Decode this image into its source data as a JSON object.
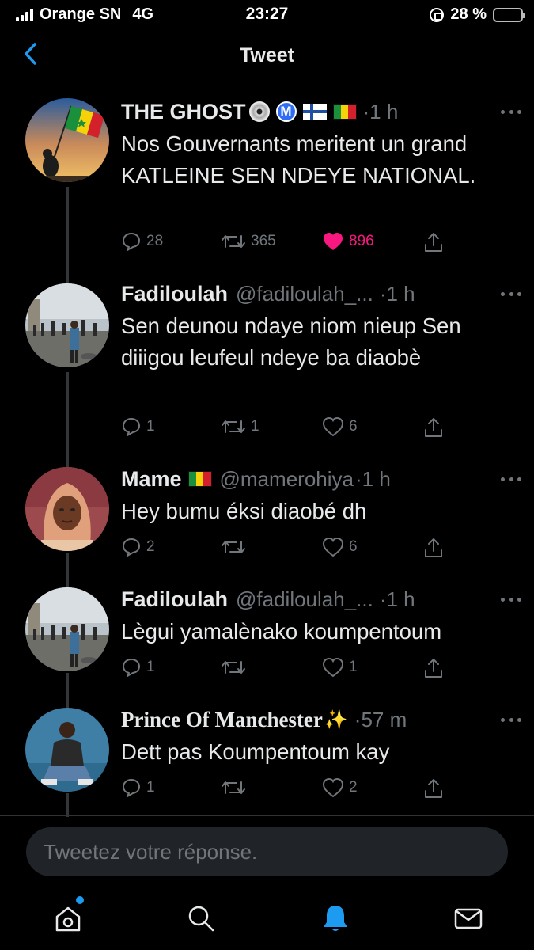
{
  "status_bar": {
    "carrier": "Orange SN",
    "network": "4G",
    "time": "23:27",
    "battery": "28 %",
    "battery_level": 0.28,
    "battery_color": "#ffcc00"
  },
  "header": {
    "title": "Tweet",
    "back_icon": "chevron-left-icon"
  },
  "tweets": [
    {
      "name": "THE GHOST",
      "handle": "",
      "time": "·1 h",
      "text": "Nos Gouvernants meritent un grand KATLEINE SEN NDEYE NATIONAL.",
      "replies": "28",
      "retweets": "365",
      "likes": "896",
      "liked": true,
      "avatar": "avatar-flag-silhouette"
    },
    {
      "name": "Fadiloulah",
      "handle": "@fadiloulah_...",
      "time": "·1 h",
      "text": "Sen deunou ndaye niom nieup Sen diiigou leufeul ndeye ba diaobè",
      "replies": "1",
      "retweets": "1",
      "likes": "6",
      "liked": false,
      "avatar": "avatar-street-protest"
    },
    {
      "name": "Mame",
      "handle": "@mamerohiya",
      "time": "·1 h",
      "text": "Hey bumu éksi diaobé dh",
      "replies": "2",
      "retweets": "",
      "likes": "6",
      "liked": false,
      "avatar": "avatar-woman-hijab"
    },
    {
      "name": "Fadiloulah",
      "handle": "@fadiloulah_...",
      "time": "·1 h",
      "text": "Lègui yamalènako koumpentoum",
      "replies": "1",
      "retweets": "",
      "likes": "1",
      "liked": false,
      "avatar": "avatar-street-protest"
    },
    {
      "name": "Prince Of Manchester",
      "handle": "",
      "time": "·57 m",
      "text": "Dett pas Koumpentoum kay",
      "replies": "1",
      "retweets": "",
      "likes": "2",
      "liked": false,
      "avatar": "avatar-man-sitting"
    }
  ],
  "reply_box": {
    "placeholder": "Tweetez votre réponse."
  },
  "tab_bar": {
    "items": [
      "home-icon",
      "search-icon",
      "notifications-icon",
      "messages-icon"
    ],
    "active": "notifications-icon",
    "active_color": "#1d9bf0"
  },
  "colors": {
    "background": "#000000",
    "text": "#e7e9ea",
    "secondary": "#71767b",
    "like": "#f91880"
  }
}
